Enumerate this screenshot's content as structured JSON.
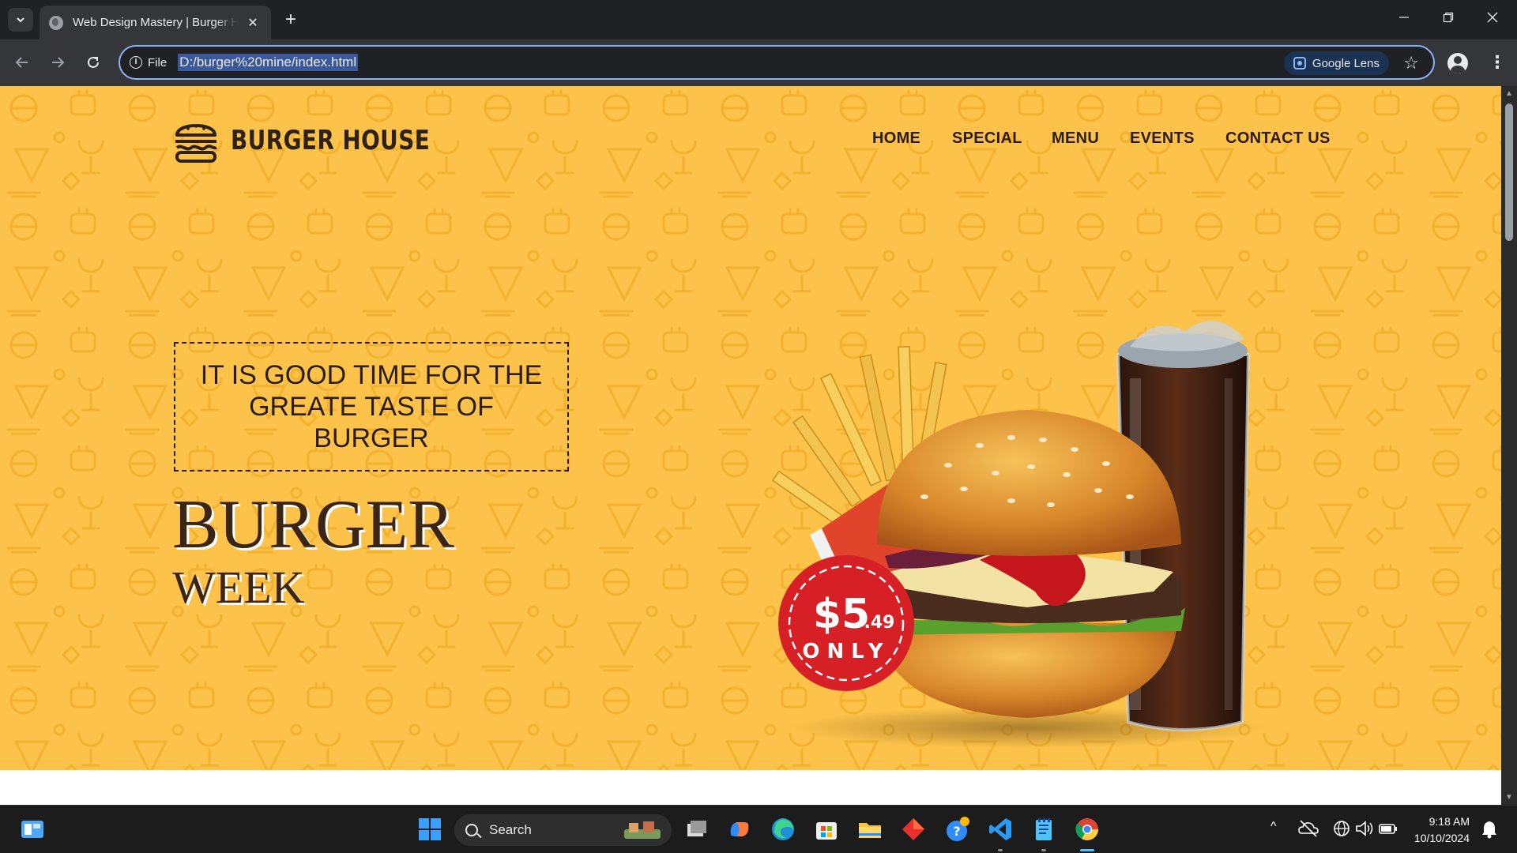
{
  "browser": {
    "tab_title": "Web Design Mastery | Burger House",
    "tab_close": "✕",
    "new_tab": "+",
    "scheme_label": "File",
    "url": "D:/burger%20mine/index.html",
    "lens_label": "Google Lens"
  },
  "site": {
    "logo_text": "BURGER HOUSE",
    "nav": [
      "HOME",
      "SPECIAL",
      "MENU",
      "EVENTS",
      "CONTACT US"
    ],
    "tagline": "IT IS GOOD TIME FOR THE GREATE TASTE OF BURGER",
    "headline_big": "BURGER",
    "headline_small": "WEEK",
    "price_main": "$5",
    "price_cents": ".49",
    "price_note": "ONLY"
  },
  "taskbar": {
    "search_placeholder": "Search",
    "time": "9:18 AM",
    "date": "10/10/2024"
  },
  "colors": {
    "hero_bg": "#fcc24a",
    "text_dark": "#2b1d14",
    "badge_red": "#d71f26",
    "omnibox_focus": "#8ab4f8"
  }
}
